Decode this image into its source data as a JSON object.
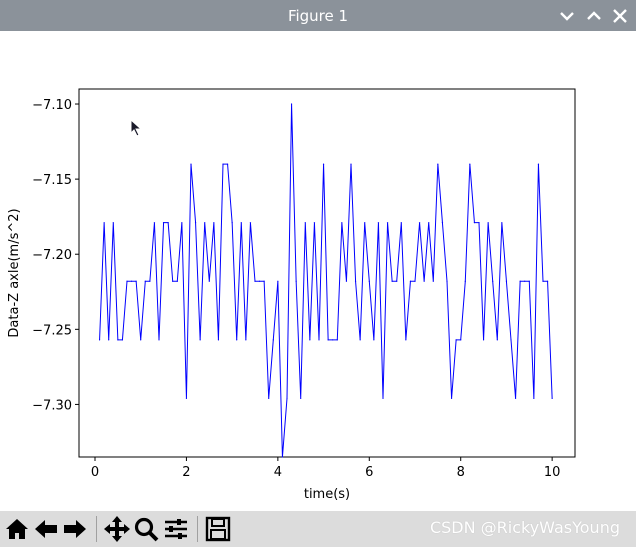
{
  "window": {
    "title": "Figure 1",
    "controls": [
      {
        "name": "minimize-button",
        "icon": "chevron-down-icon"
      },
      {
        "name": "maximize-button",
        "icon": "chevron-up-icon"
      },
      {
        "name": "close-button",
        "icon": "close-icon"
      }
    ]
  },
  "toolbar": {
    "buttons": [
      {
        "name": "home-button",
        "icon": "home-icon"
      },
      {
        "name": "back-button",
        "icon": "arrow-left-icon"
      },
      {
        "name": "forward-button",
        "icon": "arrow-right-icon"
      },
      {
        "name": "pan-button",
        "icon": "move-icon"
      },
      {
        "name": "zoom-button",
        "icon": "magnifier-icon"
      },
      {
        "name": "configure-subplots-button",
        "icon": "sliders-icon"
      },
      {
        "name": "save-button",
        "icon": "floppy-disk-icon"
      }
    ],
    "watermark": "CSDN @RickyWasYoung"
  },
  "chart_data": {
    "type": "line",
    "title": "",
    "xlabel": "time(s)",
    "ylabel": "Data-Z axle(m/s^2)",
    "xlim": [
      -0.35,
      10.5
    ],
    "ylim": [
      -7.335,
      -7.09
    ],
    "xticks": [
      0,
      2,
      4,
      6,
      8,
      10
    ],
    "xtick_labels": [
      "0",
      "2",
      "4",
      "6",
      "8",
      "10"
    ],
    "yticks": [
      -7.1,
      -7.15,
      -7.2,
      -7.25,
      -7.3
    ],
    "ytick_labels": [
      "−7.10",
      "−7.15",
      "−7.20",
      "−7.25",
      "−7.30"
    ],
    "grid": false,
    "line_color": "#0000ff",
    "series": [
      {
        "x": [
          0.1,
          0.2,
          0.3,
          0.4,
          0.5,
          0.6,
          0.7,
          0.8,
          0.9,
          1.0,
          1.1,
          1.2,
          1.3,
          1.4,
          1.5,
          1.6,
          1.7,
          1.8,
          1.9,
          2.0,
          2.1,
          2.2,
          2.3,
          2.4,
          2.5,
          2.6,
          2.7,
          2.8,
          2.9,
          3.0,
          3.1,
          3.2,
          3.3,
          3.4,
          3.5,
          3.6,
          3.7,
          3.8,
          3.9,
          4.0,
          4.1,
          4.2,
          4.3,
          4.4,
          4.5,
          4.6,
          4.7,
          4.8,
          4.9,
          5.0,
          5.1,
          5.2,
          5.3,
          5.4,
          5.5,
          5.6,
          5.7,
          5.8,
          5.9,
          6.0,
          6.1,
          6.2,
          6.3,
          6.4,
          6.5,
          6.6,
          6.7,
          6.8,
          6.9,
          7.0,
          7.1,
          7.2,
          7.3,
          7.4,
          7.5,
          7.6,
          7.7,
          7.8,
          7.9,
          8.0,
          8.1,
          8.2,
          8.3,
          8.4,
          8.5,
          8.6,
          8.7,
          8.8,
          8.9,
          9.0,
          9.1,
          9.2,
          9.3,
          9.4,
          9.5,
          9.6,
          9.7,
          9.8,
          9.9,
          10.0
        ],
        "y": [
          -7.257,
          -7.179,
          -7.257,
          -7.179,
          -7.257,
          -7.257,
          -7.218,
          -7.218,
          -7.218,
          -7.257,
          -7.218,
          -7.218,
          -7.179,
          -7.257,
          -7.179,
          -7.179,
          -7.218,
          -7.218,
          -7.179,
          -7.296,
          -7.14,
          -7.179,
          -7.257,
          -7.179,
          -7.218,
          -7.179,
          -7.257,
          -7.14,
          -7.14,
          -7.179,
          -7.257,
          -7.179,
          -7.257,
          -7.179,
          -7.218,
          -7.218,
          -7.218,
          -7.296,
          -7.257,
          -7.218,
          -7.335,
          -7.296,
          -7.1,
          -7.218,
          -7.296,
          -7.179,
          -7.257,
          -7.179,
          -7.257,
          -7.14,
          -7.257,
          -7.257,
          -7.257,
          -7.179,
          -7.218,
          -7.14,
          -7.218,
          -7.257,
          -7.179,
          -7.218,
          -7.257,
          -7.179,
          -7.296,
          -7.179,
          -7.218,
          -7.218,
          -7.179,
          -7.257,
          -7.218,
          -7.218,
          -7.179,
          -7.218,
          -7.179,
          -7.218,
          -7.14,
          -7.179,
          -7.218,
          -7.296,
          -7.257,
          -7.257,
          -7.218,
          -7.14,
          -7.179,
          -7.179,
          -7.257,
          -7.179,
          -7.218,
          -7.257,
          -7.179,
          -7.218,
          -7.257,
          -7.296,
          -7.218,
          -7.218,
          -7.218,
          -7.296,
          -7.14,
          -7.218,
          -7.218,
          -7.296
        ]
      }
    ]
  }
}
